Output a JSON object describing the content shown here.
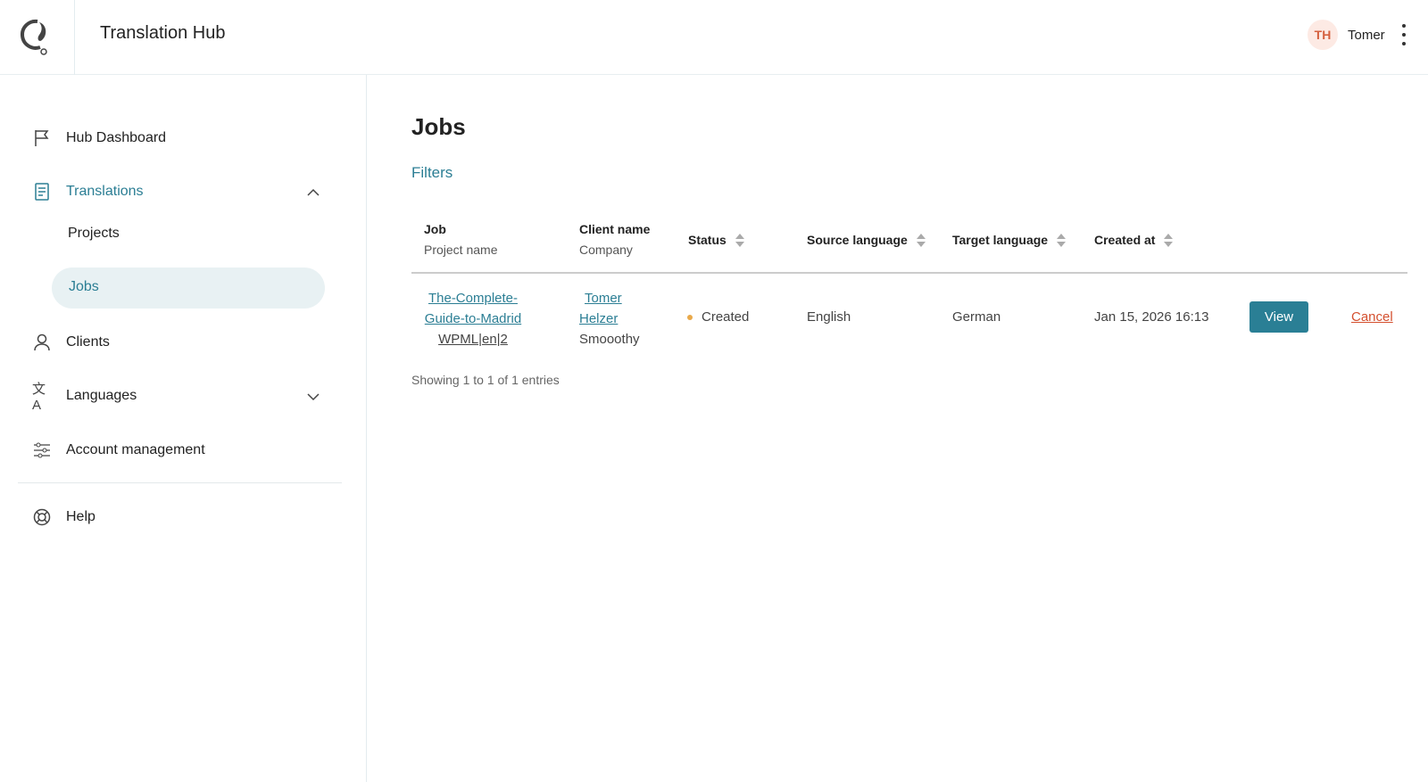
{
  "header": {
    "title": "Translation Hub",
    "user_initials": "TH",
    "user_name": "Tomer"
  },
  "sidebar": {
    "items": [
      {
        "label": "Hub Dashboard"
      },
      {
        "label": "Translations"
      },
      {
        "label": "Clients"
      },
      {
        "label": "Languages"
      },
      {
        "label": "Account management"
      },
      {
        "label": "Help"
      }
    ],
    "sub_items": [
      {
        "label": "Projects"
      },
      {
        "label": "Jobs"
      }
    ]
  },
  "main": {
    "title": "Jobs",
    "filters_label": "Filters",
    "columns": {
      "job": "Job",
      "project_name": "Project name",
      "client_name": "Client name",
      "company": "Company",
      "status": "Status",
      "source": "Source language",
      "target": "Target language",
      "created": "Created at"
    },
    "rows": [
      {
        "job_line1": "The-Complete-",
        "job_line2": "Guide-to-Madrid",
        "project": "WPML|en|2",
        "client_line1": "Tomer",
        "client_line2": "Helzer",
        "company": "Smooothy",
        "status": "Created",
        "source": "English",
        "target": "German",
        "created": "Jan 15, 2026 16:13",
        "view_label": "View",
        "cancel_label": "Cancel"
      }
    ],
    "footer": "Showing 1 to 1 of 1 entries"
  },
  "colors": {
    "accent": "#2b7e94",
    "status_created": "#e9a94a",
    "cancel": "#d4502f"
  }
}
